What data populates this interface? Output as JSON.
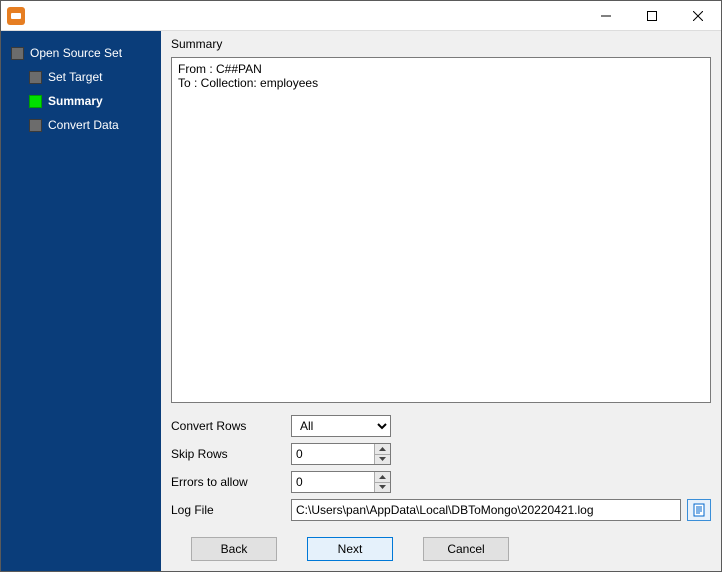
{
  "titlebar": {
    "title": ""
  },
  "sidebar": {
    "steps": [
      {
        "label": "Open Source Set",
        "active": false,
        "indent": false
      },
      {
        "label": "Set Target",
        "active": false,
        "indent": true
      },
      {
        "label": "Summary",
        "active": true,
        "indent": true
      },
      {
        "label": "Convert Data",
        "active": false,
        "indent": true
      }
    ]
  },
  "main": {
    "summary_label": "Summary",
    "summary_text": "From : C##PAN\nTo : Collection: employees",
    "convert_rows_label": "Convert Rows",
    "convert_rows_value": "All",
    "convert_rows_options": [
      "All"
    ],
    "skip_rows_label": "Skip Rows",
    "skip_rows_value": "0",
    "errors_label": "Errors to allow",
    "errors_value": "0",
    "log_file_label": "Log File",
    "log_file_value": "C:\\Users\\pan\\AppData\\Local\\DBToMongo\\20220421.log"
  },
  "footer": {
    "back": "Back",
    "next": "Next",
    "cancel": "Cancel"
  }
}
